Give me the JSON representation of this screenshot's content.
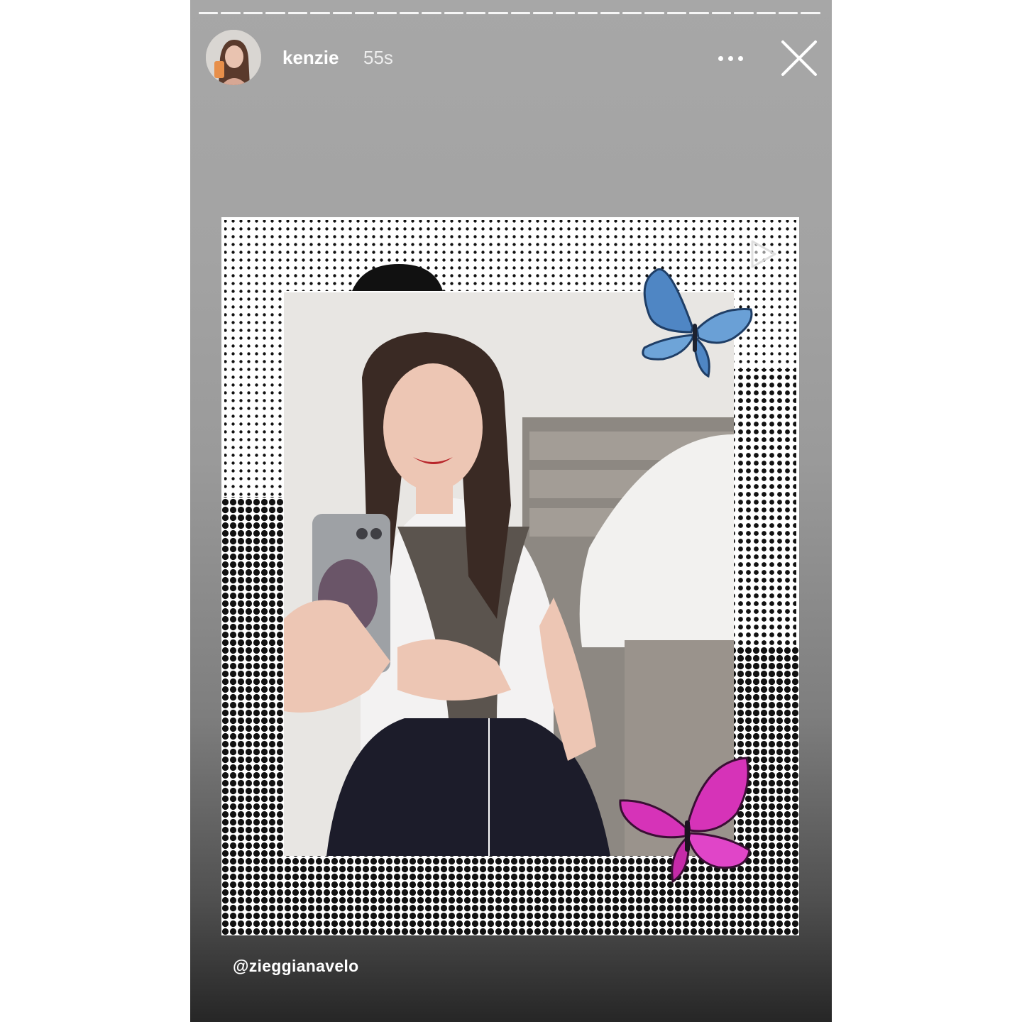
{
  "story": {
    "progress_segments": 28,
    "username": "kenzie",
    "elapsed": "55s",
    "more_icon": "more-horizontal-icon",
    "close_icon": "close-icon",
    "mention": "@zieggianavelo"
  },
  "card": {
    "play_icon": "play-icon",
    "sticker_top": "blue-butterfly-icon",
    "sticker_bottom": "pink-butterfly-icon"
  },
  "colors": {
    "butterfly_blue": "#4f86c4",
    "butterfly_pink": "#d633b8",
    "halftone": "#111111"
  }
}
